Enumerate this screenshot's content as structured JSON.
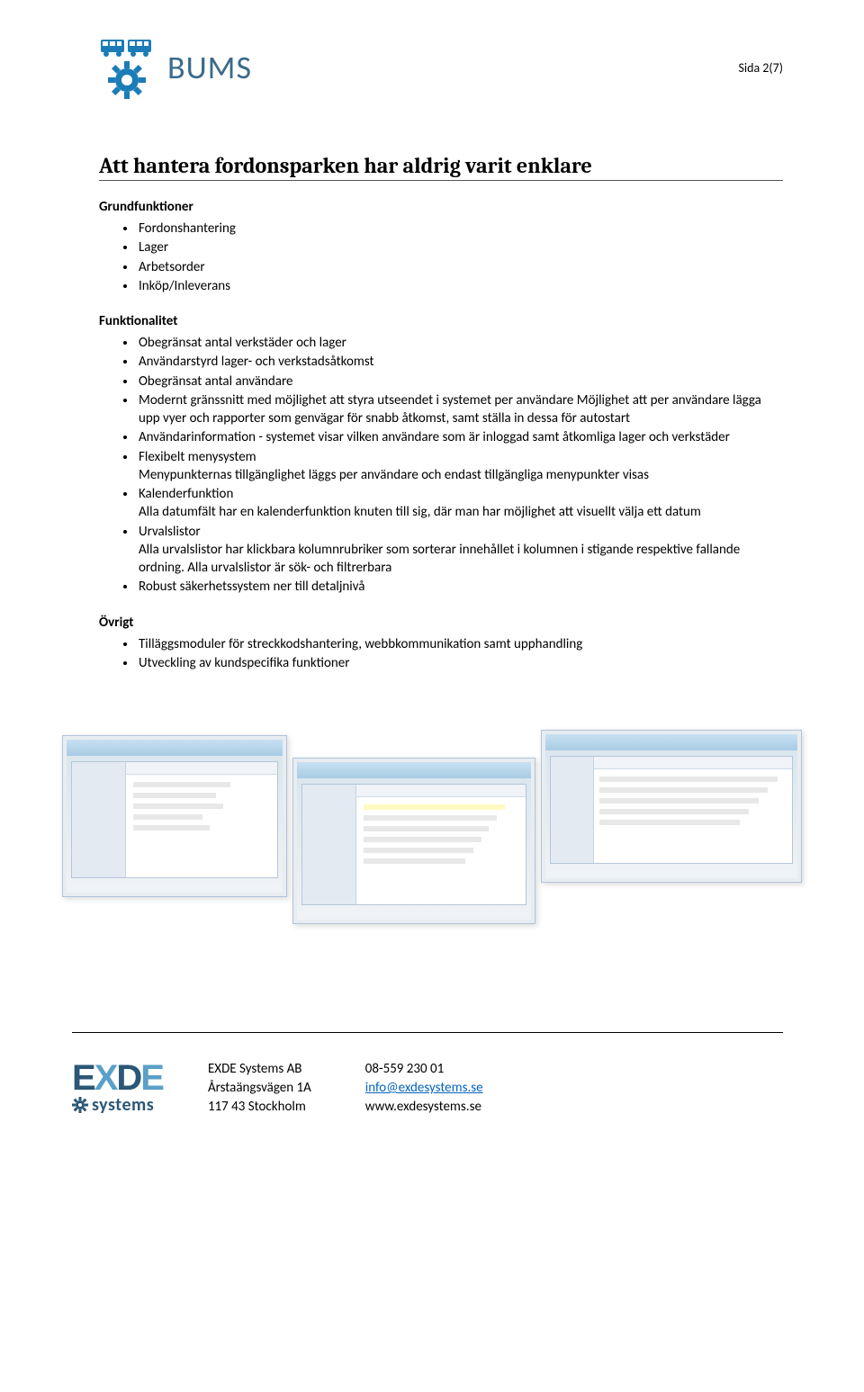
{
  "header": {
    "logo_text": "BUMS",
    "page_number": "Sida 2(7)"
  },
  "title": "Att hantera fordonsparken har aldrig varit enklare",
  "sections": [
    {
      "heading": "Grundfunktioner",
      "items": [
        "Fordonshantering",
        "Lager",
        "Arbetsorder",
        "Inköp/Inleverans"
      ]
    },
    {
      "heading": "Funktionalitet",
      "items": [
        "Obegränsat antal verkstäder och lager",
        "Användarstyrd lager- och verkstadsåtkomst",
        "Obegränsat antal användare",
        "Modernt gränssnitt med möjlighet att styra utseendet i systemet per användare Möjlighet att per användare lägga upp vyer och rapporter som genvägar för snabb åtkomst, samt ställa in dessa för autostart",
        "Användarinformation - systemet visar vilken användare som är inloggad samt åtkomliga lager och verkstäder",
        "Flexibelt menysystem\nMenypunkternas tillgänglighet läggs per användare och endast tillgängliga menypunkter visas",
        "Kalenderfunktion\nAlla datumfält har en kalenderfunktion knuten till sig, där man har möjlighet att visuellt välja ett datum",
        "Urvalslistor\nAlla urvalslistor har klickbara kolumnrubriker som sorterar innehållet i kolumnen i stigande respektive fallande ordning. Alla urvalslistor är sök- och filtrerbara",
        "Robust säkerhetssystem ner till detaljnivå"
      ]
    },
    {
      "heading": "Övrigt",
      "items": [
        "Tilläggsmoduler för streckkodshantering, webbkommunikation samt upphandling",
        "Utveckling av kundspecifika funktioner"
      ]
    }
  ],
  "footer": {
    "logo_top1": "E",
    "logo_top2": "X",
    "logo_top3": "D",
    "logo_top4": "E",
    "logo_sub": "systems",
    "col1": {
      "line1": "EXDE Systems AB",
      "line2": "Årstaängsvägen 1A",
      "line3": "117 43 Stockholm"
    },
    "col2": {
      "line1": "08-559 230 01",
      "line2": "info@exdesystems.se",
      "line3": "www.exdesystems.se"
    }
  }
}
